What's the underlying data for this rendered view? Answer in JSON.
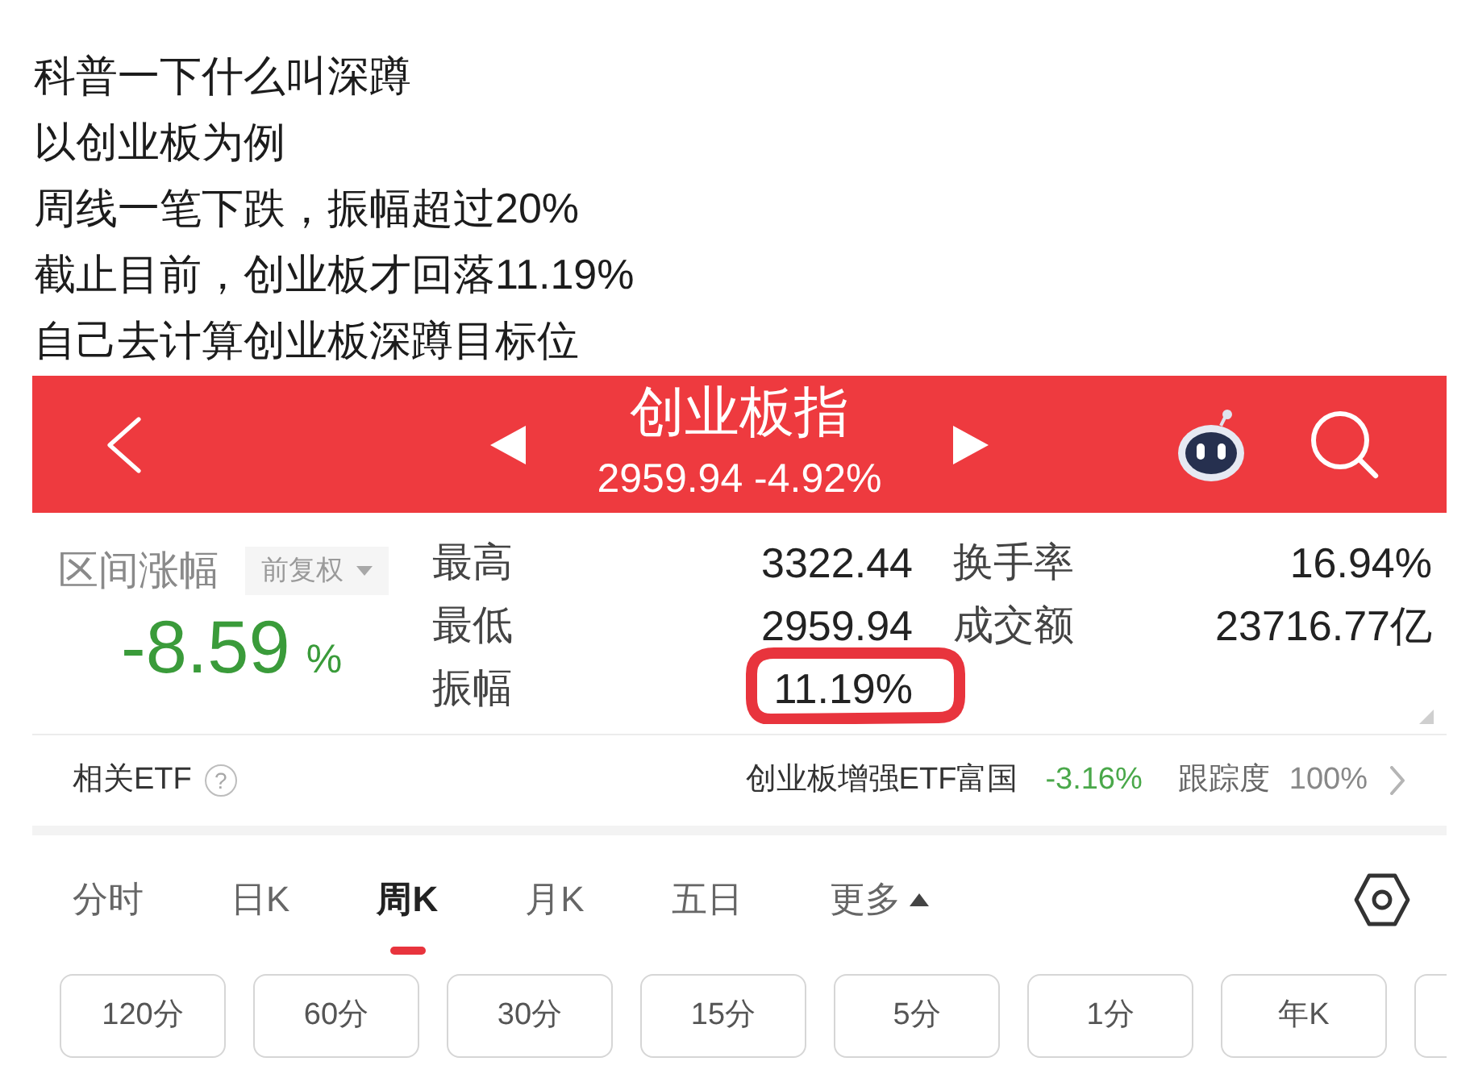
{
  "post_lines": [
    "科普一下什么叫深蹲",
    "以创业板为例",
    "周线一笔下跌，振幅超过20%",
    "截止目前，创业板才回落11.19%",
    "自己去计算创业板深蹲目标位"
  ],
  "header": {
    "title": "创业板指",
    "quote": "2959.94 -4.92%"
  },
  "summary": {
    "label": "区间涨幅",
    "adjust": "前复权",
    "change": "-8.59",
    "unit": "%"
  },
  "stats": [
    {
      "label": "最高",
      "value": "3322.44",
      "highlighted": false
    },
    {
      "label": "换手率",
      "value": "16.94%",
      "highlighted": false
    },
    {
      "label": "最低",
      "value": "2959.94",
      "highlighted": false
    },
    {
      "label": "成交额",
      "value": "23716.77亿",
      "highlighted": false
    },
    {
      "label": "振幅",
      "value": "11.19%",
      "highlighted": true
    }
  ],
  "etf": {
    "label": "相关ETF",
    "help": "?",
    "name": "创业板增强ETF富国",
    "change": "-3.16%",
    "tracking_label": "跟踪度",
    "tracking": "100%"
  },
  "tabs": [
    {
      "label": "分时",
      "selected": false,
      "has_menu": false
    },
    {
      "label": "日K",
      "selected": false,
      "has_menu": false
    },
    {
      "label": "周K",
      "selected": true,
      "has_menu": false
    },
    {
      "label": "月K",
      "selected": false,
      "has_menu": false
    },
    {
      "label": "五日",
      "selected": false,
      "has_menu": false
    },
    {
      "label": "更多",
      "selected": false,
      "has_menu": true
    }
  ],
  "period_buttons": [
    {
      "kind": "button",
      "label": "120分"
    },
    {
      "kind": "button",
      "label": "60分"
    },
    {
      "kind": "button",
      "label": "30分"
    },
    {
      "kind": "button",
      "label": "15分"
    },
    {
      "kind": "button",
      "label": "5分"
    },
    {
      "kind": "button",
      "label": "1分"
    },
    {
      "kind": "button",
      "label": "年K"
    },
    {
      "kind": "cut"
    }
  ]
}
